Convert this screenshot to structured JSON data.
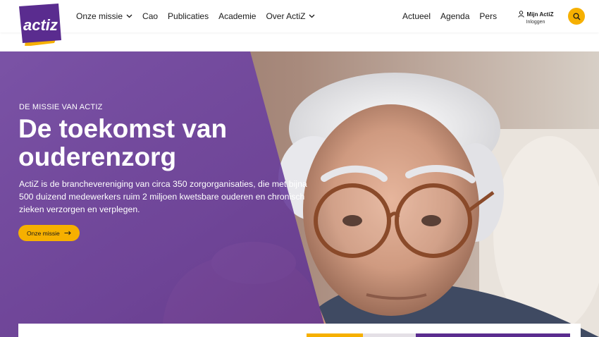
{
  "brand": {
    "logo_text": "actiz",
    "colors": {
      "purple": "#5a2c8f",
      "yellow": "#f6b000"
    }
  },
  "nav": {
    "left": [
      {
        "label": "Onze missie",
        "dropdown": true
      },
      {
        "label": "Cao",
        "dropdown": false
      },
      {
        "label": "Publicaties",
        "dropdown": false
      },
      {
        "label": "Academie",
        "dropdown": false
      },
      {
        "label": "Over ActiZ",
        "dropdown": true
      }
    ],
    "right": [
      {
        "label": "Actueel"
      },
      {
        "label": "Agenda"
      },
      {
        "label": "Pers"
      }
    ]
  },
  "account": {
    "label": "Mijn ActiZ",
    "sub": "Inloggen",
    "icon": "user-icon"
  },
  "search": {
    "icon": "search-icon"
  },
  "hero": {
    "eyebrow": "DE MISSIE VAN ACTIZ",
    "title": "De toekomst van ouderenzorg",
    "text": "ActiZ is de branchevereniging van circa 350 zorgorganisaties, die met bijna 500 duizend medewerkers ruim 2 miljoen kwetsbare ouderen en chronisch zieken verzorgen en verplegen.",
    "cta": "Onze missie"
  }
}
